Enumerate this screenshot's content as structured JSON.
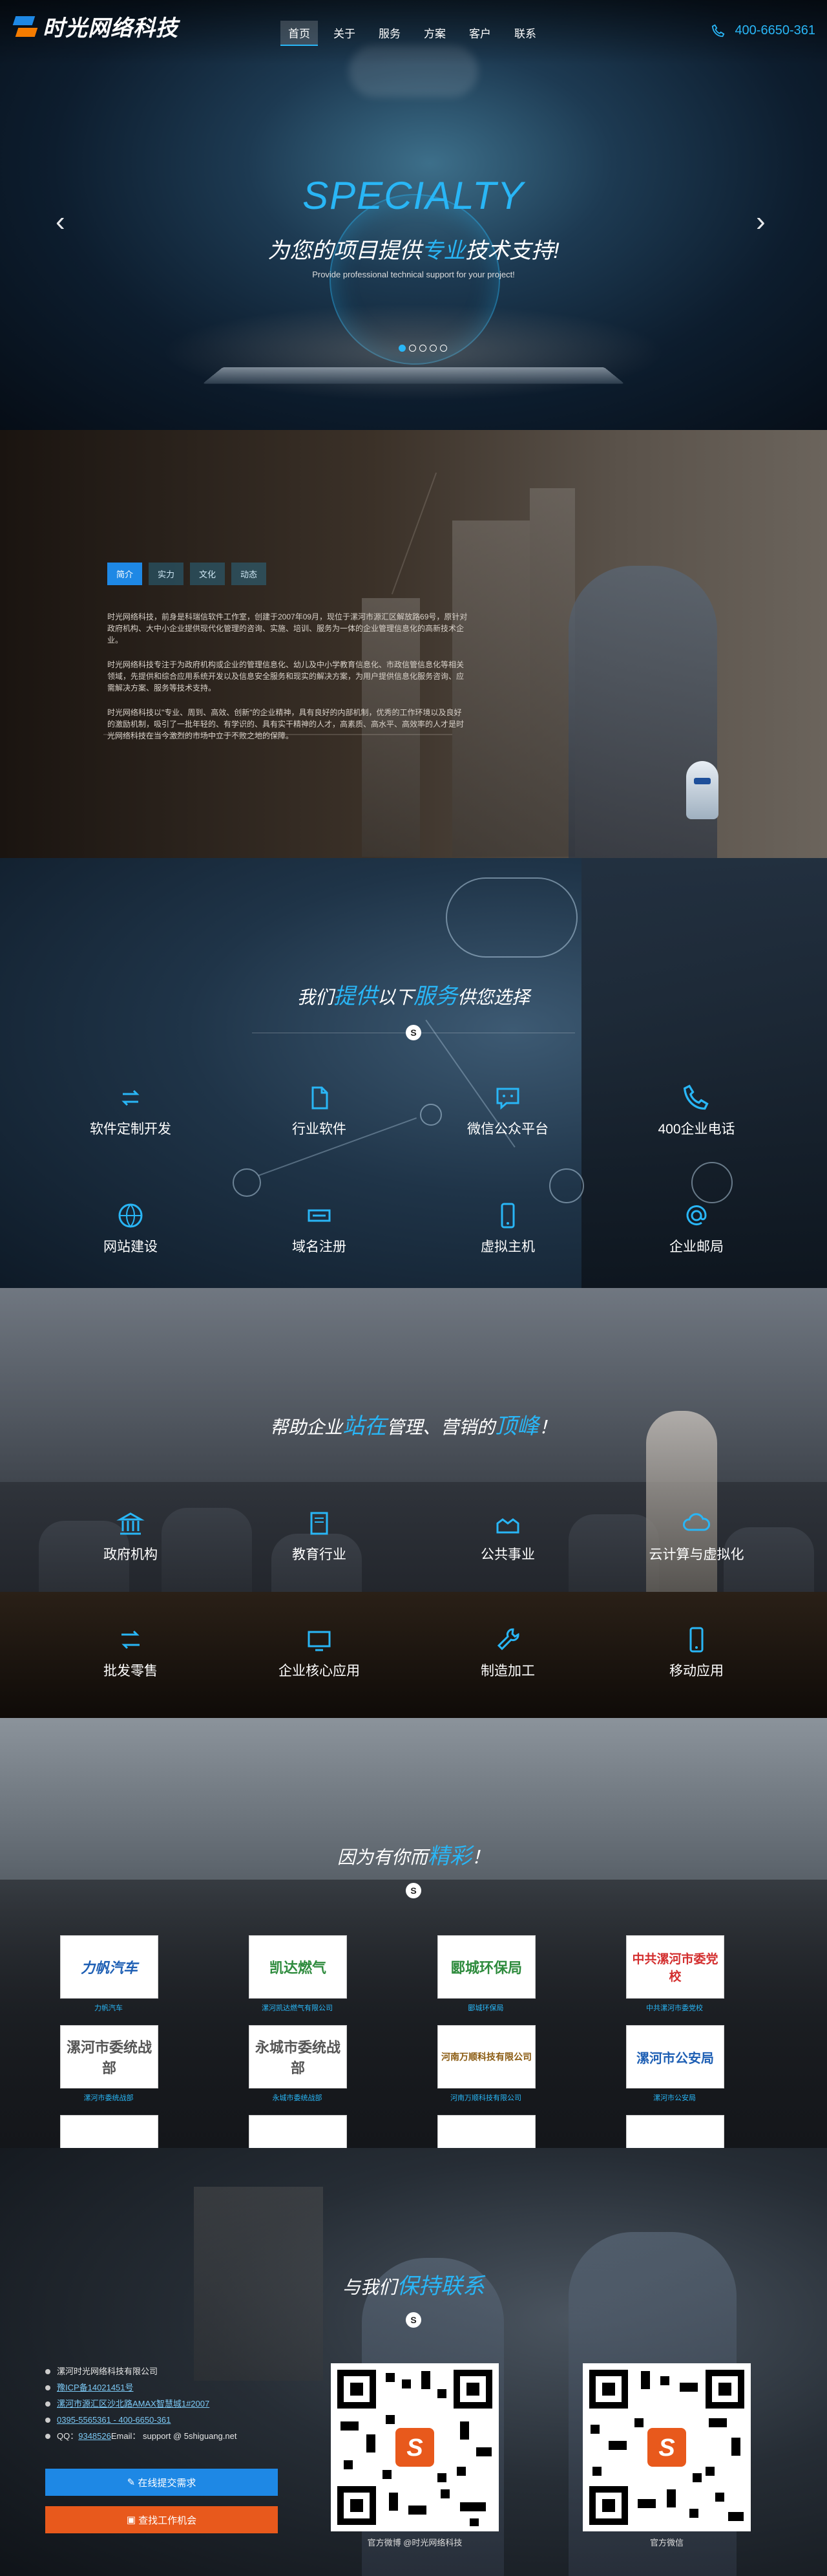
{
  "nav": {
    "logo_text": "时光网络科技",
    "items": [
      {
        "label": "首页",
        "active": true
      },
      {
        "label": "关于",
        "active": false
      },
      {
        "label": "服务",
        "active": false
      },
      {
        "label": "方案",
        "active": false
      },
      {
        "label": "客户",
        "active": false
      },
      {
        "label": "联系",
        "active": false
      }
    ],
    "phone": "400-6650-361"
  },
  "hero": {
    "title": "SPECIALTY",
    "subtitle_pre": "为您的项目提供",
    "subtitle_highlight": "专业",
    "subtitle_post": "技术支持!",
    "subtitle_en": "Provide professional technical support for your project!",
    "slide_count": 5,
    "active_slide": 1
  },
  "intro": {
    "tabs": [
      "简介",
      "实力",
      "文化",
      "动态"
    ],
    "paragraphs": [
      "时光网络科技，前身是科瑞信软件工作室，创建于2007年09月，现位于漯河市源汇区解放路69号，原针对政府机构、大中小企业提供现代化管理的咨询、实施、培训、服务为一体的企业管理信息化的高新技术企业。",
      "时光网络科技专注于为政府机构或企业的管理信息化、幼儿及中小学教育信息化、市政信管信息化等相关领域，先提供和综合应用系统开发以及信息安全服务和现实的解决方案，为用户提供信息化服务咨询、应需解决方案、服务等技术支持。",
      "时光网络科技以\"专业、周到、高效、创新\"的企业精神，具有良好的内部机制，优秀的工作环境以及良好的激励机制，吸引了一批年轻的、有学识的、具有实干精神的人才，高素质、高水平、高效率的人才是时光网络科技在当今激烈的市场中立于不败之地的保障。"
    ]
  },
  "services": {
    "heading_pre": "我们",
    "heading_hl1": "提供",
    "heading_mid": "以下",
    "heading_hl2": "服务",
    "heading_post": "供您选择",
    "items": [
      {
        "label": "软件定制开发",
        "icon": "refresh-icon"
      },
      {
        "label": "行业软件",
        "icon": "document-icon"
      },
      {
        "label": "微信公众平台",
        "icon": "chat-icon"
      },
      {
        "label": "400企业电话",
        "icon": "phone-icon"
      },
      {
        "label": "网站建设",
        "icon": "globe-icon"
      },
      {
        "label": "域名注册",
        "icon": "domain-icon"
      },
      {
        "label": "虚拟主机",
        "icon": "mobile-icon"
      },
      {
        "label": "企业邮局",
        "icon": "at-icon"
      }
    ]
  },
  "industry": {
    "heading_pre": "帮助企业",
    "heading_hl1": "站在",
    "heading_mid": "管理、营销的",
    "heading_hl2": "顶峰",
    "heading_post": "！",
    "items": [
      {
        "label": "政府机构",
        "icon": "government-icon"
      },
      {
        "label": "教育行业",
        "icon": "book-icon"
      },
      {
        "label": "公共事业",
        "icon": "public-icon"
      },
      {
        "label": "云计算与虚拟化",
        "icon": "cloud-icon"
      },
      {
        "label": "批发零售",
        "icon": "exchange-icon"
      },
      {
        "label": "企业核心应用",
        "icon": "monitor-icon"
      },
      {
        "label": "制造加工",
        "icon": "wrench-icon"
      },
      {
        "label": "移动应用",
        "icon": "mobile-app-icon"
      }
    ]
  },
  "clients": {
    "heading_pre": "因为有你而",
    "heading_hl": "精彩",
    "heading_post": "！",
    "logos": [
      {
        "name": "力帆汽车",
        "caption": "力帆汽车"
      },
      {
        "name": "凯达燃气",
        "caption": "漯河凯达燃气有限公司"
      },
      {
        "name": "郾城环保局",
        "caption": "郾城环保局"
      },
      {
        "name": "中共漯河市委党校",
        "caption": "中共漯河市委党校"
      },
      {
        "name": "漯河市委统战部",
        "caption": "漯河市委统战部"
      },
      {
        "name": "永城市委统战部",
        "caption": "永城市委统战部"
      },
      {
        "name": "河南万顺科技有限公司",
        "caption": "河南万顺科技有限公司"
      },
      {
        "name": "漯河市公安局",
        "caption": "漯河市公安局"
      }
    ]
  },
  "contact": {
    "heading_pre": "与我们",
    "heading_hl": "保持联系",
    "company": "漯河时光网络科技有限公司",
    "icp": "豫ICP备14021451号",
    "address": "漯河市源汇区沙北路AMAX智慧城1#2007",
    "phones": "0395-5565361 - 400-6650-361",
    "qq_label": "QQ：",
    "qq": "9348526",
    "email_label": " Email：",
    "email": "support @ 5shiguang.net",
    "btn_submit": "在线提交需求",
    "btn_jobs": "查找工作机会",
    "qr1_caption": "官方微博 @时光网络科技",
    "qr2_caption": "官方微信"
  }
}
